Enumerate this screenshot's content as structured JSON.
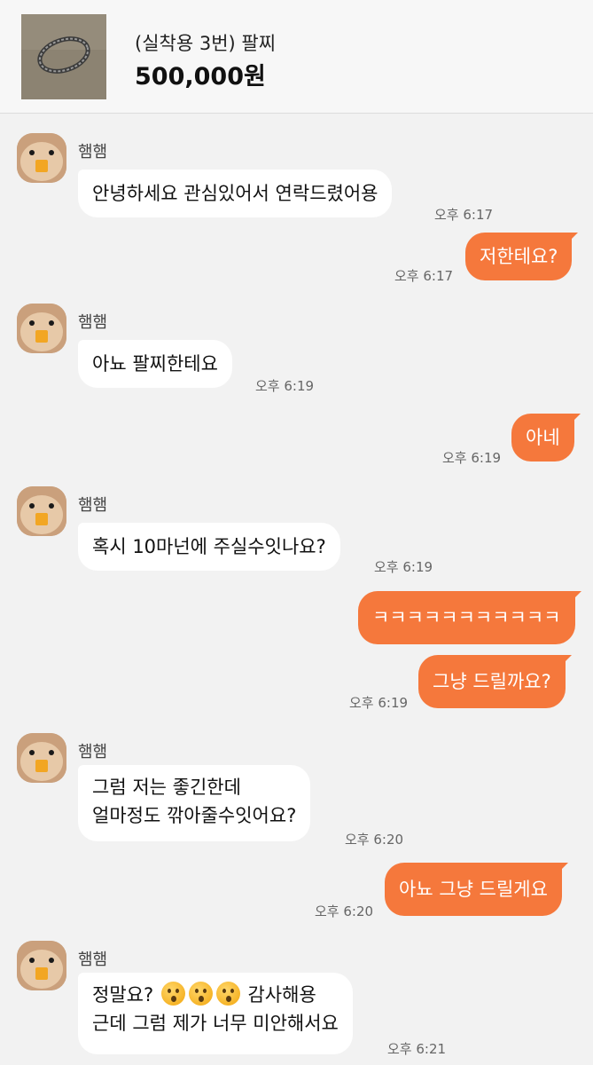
{
  "product": {
    "title": "(실착용 3번) 팔찌",
    "price": "500,000원"
  },
  "colors": {
    "accent": "#f5783c",
    "background": "#f2f2f2",
    "incoming_bubble": "#ffffff"
  },
  "messages": [
    {
      "sender": "햄햄",
      "text": "안녕하세요 관심있어서 연락드렸어용",
      "time": "오후 6:17"
    },
    {
      "text": "저한테요?",
      "time": "오후 6:17"
    },
    {
      "sender": "햄햄",
      "text": "아뇨 팔찌한테요",
      "time": "오후 6:19"
    },
    {
      "text": "아네",
      "time": "오후 6:19"
    },
    {
      "sender": "햄햄",
      "text": "혹시 10마넌에 주실수잇나요?",
      "time": "오후 6:19"
    },
    {
      "text": "ㅋㅋㅋㅋㅋㅋㅋㅋㅋㅋㅋ"
    },
    {
      "text": "그냥 드릴까요?",
      "time": "오후 6:19"
    },
    {
      "sender": "햄햄",
      "text": "그럼 저는 좋긴한데\n얼마정도 깎아줄수잇어요?",
      "time": "오후 6:20"
    },
    {
      "text": "아뇨 그냥 드릴게요",
      "time": "오후 6:20"
    },
    {
      "sender": "햄햄",
      "text_before_emoji": "정말요?",
      "emoji": "hushed-face-emoji",
      "text_after_emoji": "감사해용",
      "text_line2": "근데 그럼 제가 너무 미안해서요",
      "time": "오후 6:21"
    }
  ]
}
